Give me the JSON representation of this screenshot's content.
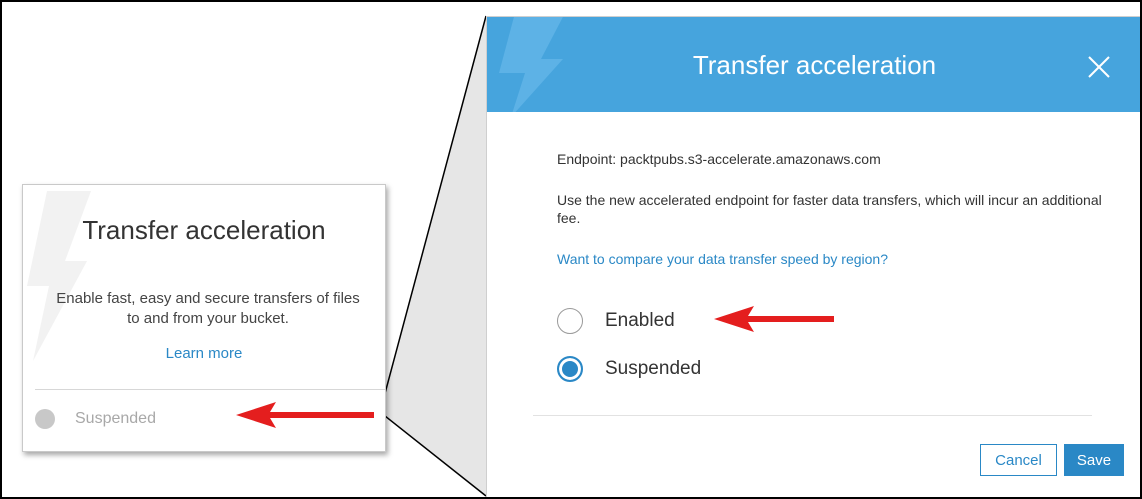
{
  "card": {
    "title": "Transfer acceleration",
    "description": "Enable fast, easy and secure transfers of files to and from your bucket.",
    "learn_more": "Learn more",
    "status": "Suspended"
  },
  "dialog": {
    "title": "Transfer acceleration",
    "endpoint": "Endpoint: packtpubs.s3-accelerate.amazonaws.com",
    "description": "Use the new accelerated endpoint for faster data transfers, which will incur an additional fee.",
    "compare_link": "Want to compare your data transfer speed by region?",
    "options": [
      {
        "label": "Enabled",
        "checked": false
      },
      {
        "label": "Suspended",
        "checked": true
      }
    ],
    "cancel_label": "Cancel",
    "save_label": "Save"
  },
  "colors": {
    "header": "#46a4dd",
    "accent": "#2a88c6",
    "arrow": "#e41e1e"
  },
  "icons": {
    "close": "close-icon",
    "bolt": "lightning-bolt-icon",
    "arrow": "red-arrow-icon"
  }
}
